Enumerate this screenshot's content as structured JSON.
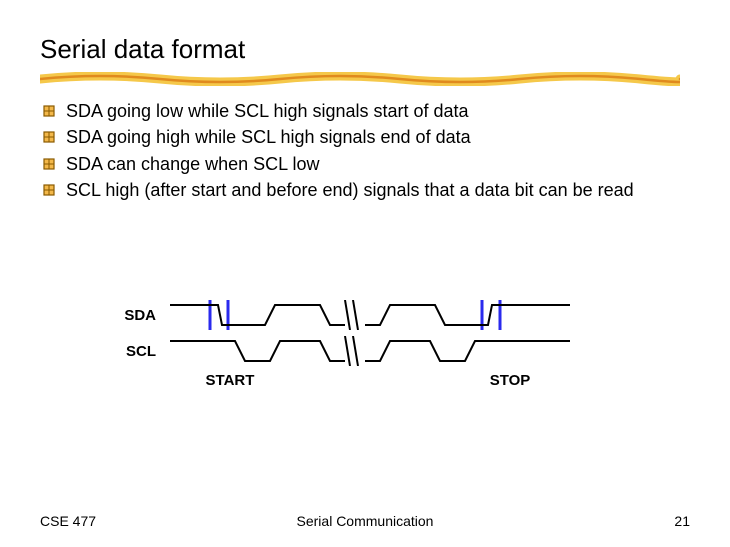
{
  "title": "Serial data format",
  "bullets": {
    "b0": "SDA going low while SCL high signals start of data",
    "b1": "SDA going high while SCL high signals end of data",
    "b2": "SDA can change when SCL low",
    "b3": "SCL high (after start and before end) signals that a data bit can be read"
  },
  "diagram": {
    "sda_label": "SDA",
    "scl_label": "SCL",
    "start_label": "START",
    "stop_label": "STOP"
  },
  "footer": {
    "left": "CSE 477",
    "center": "Serial Communication",
    "page": "21"
  },
  "colors": {
    "accent_yellow": "#f5c84a",
    "accent_orange": "#e08a1e",
    "bullet_fill": "#f3b84a",
    "bullet_stroke": "#8a5a00",
    "box_stroke": "#2a2aee",
    "wave_stroke": "#000000"
  }
}
